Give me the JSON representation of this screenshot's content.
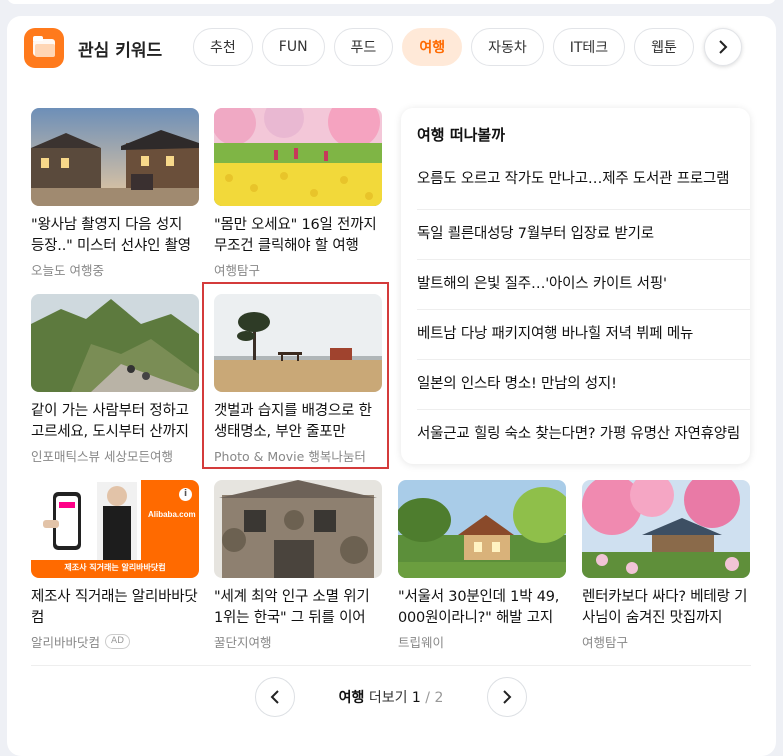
{
  "header": {
    "title": "관심 키워드",
    "icon": "folder-icon"
  },
  "chips": [
    {
      "label": "추천",
      "active": false
    },
    {
      "label": "FUN",
      "active": false
    },
    {
      "label": "푸드",
      "active": false
    },
    {
      "label": "여행",
      "active": true
    },
    {
      "label": "자동차",
      "active": false
    },
    {
      "label": "IT테크",
      "active": false
    },
    {
      "label": "웹툰",
      "active": false
    }
  ],
  "items": [
    {
      "title": "\"왕사남 촬영지 다음 성지 등장..\" 미스터 선샤인 촬영지",
      "source": "오늘도 여행중",
      "ad": false
    },
    {
      "title": "\"몸만 오세요\" 16일 전까지 무조건 클릭해야 할 여행",
      "source": "여행탐구",
      "ad": false
    },
    {
      "title": "같이 가는 사람부터 정하고 고르세요, 도시부터 산까지",
      "source": "인포매틱스뷰 세상모든여행",
      "ad": false
    },
    {
      "title": "갯벌과 습지를 배경으로 한 생태명소, 부안 줄포만",
      "source": "Photo & Movie 행복나눔터",
      "ad": false
    },
    {
      "title": "제조사 직거래는 알리바바닷컴",
      "source": "알리바바닷컴",
      "ad": true,
      "ad_label": "AD"
    },
    {
      "title": "\"세계 최악 인구 소멸 위기 1위는 한국\" 그 뒤를 이어",
      "source": "꿀단지여행",
      "ad": false
    },
    {
      "title": "\"서울서 30분인데 1박 49,000원이라니?\" 해발 고지",
      "source": "트립웨이",
      "ad": false
    },
    {
      "title": "렌터카보다 싸다? 베테랑 기사님이 숨겨진 맛집까지",
      "source": "여행탐구",
      "ad": false
    }
  ],
  "ad_banner": {
    "brand": "Alibaba.com",
    "caption": "제조사 직거래는 알리바바닷컴",
    "badge": "i"
  },
  "panel": {
    "title": "여행 떠나볼까",
    "items": [
      "오름도 오르고 작가도 만나고…제주 도서관 프로그램",
      "독일 쾰른대성당 7월부터 입장료 받기로",
      "발트해의 은빛 질주…'아이스 카이트 서핑'",
      "베트남 다낭 패키지여행 바나힐 저녁 뷔페 메뉴",
      "일본의 인스타 명소! 만남의 성지!",
      "서울근교 힐링 숙소 찾는다면? 가평 유명산 자연휴양림"
    ]
  },
  "pager": {
    "category": "여행",
    "more_label": "더보기",
    "current": "1",
    "separator": "/",
    "total": "2"
  },
  "colors": {
    "accent": "#ff6a00",
    "active_chip_bg": "#ffe9d8",
    "highlight_border": "#d43b3b"
  }
}
